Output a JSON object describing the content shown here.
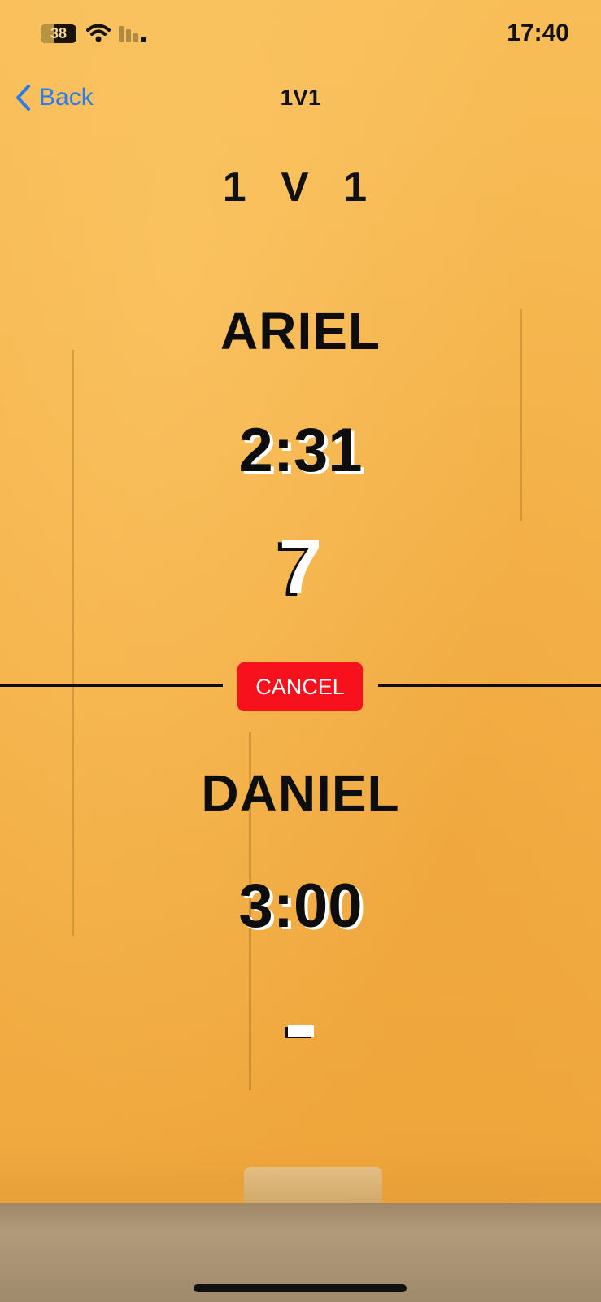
{
  "status_bar": {
    "battery_level": "38",
    "battery_fraction": 0.38,
    "time": "17:40",
    "wifi_icon": "wifi-icon",
    "signal_icon": "cellular-signal-icon"
  },
  "nav": {
    "back_label": "Back",
    "back_icon": "chevron-left-icon",
    "title": "1V1"
  },
  "game": {
    "mode_title": "1 V 1",
    "player_one": {
      "name": "ARIEL",
      "timer": "2:31",
      "score": "7"
    },
    "cancel_label": "CANCEL",
    "player_two": {
      "name": "DANIEL",
      "timer": "3:00",
      "score": "-"
    }
  },
  "colors": {
    "background": "#f6b74f",
    "accent_link": "#2a7bf0",
    "cancel_button": "#f7111d",
    "text": "#0d0d0d"
  }
}
